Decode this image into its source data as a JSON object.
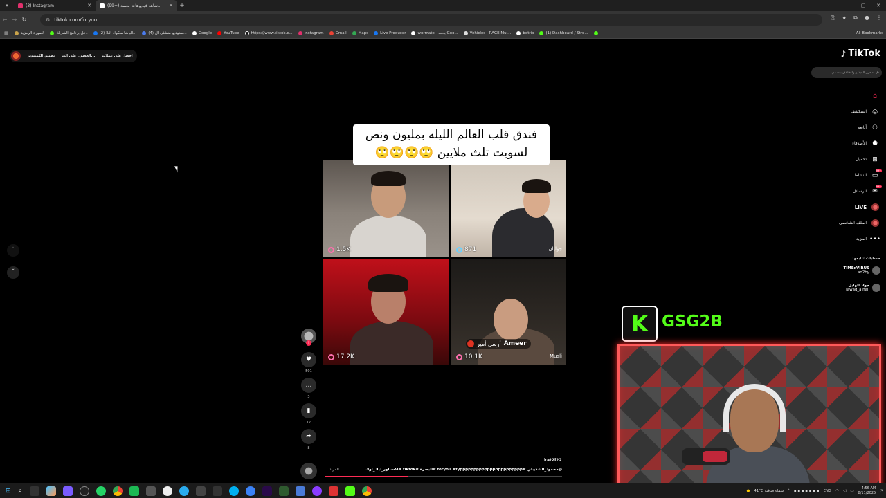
{
  "browser": {
    "tabs": [
      {
        "title": "(3) Instagram",
        "color": "#e1306c",
        "active": false
      },
      {
        "title": "(99+) شاهد فيديوهات متصد...",
        "color": "#ffffff",
        "active": true
      }
    ],
    "url": "tiktok.com/foryou",
    "bookmarks": [
      {
        "label": "الصورة الرمزية",
        "color": "#c9a34b"
      },
      {
        "label": "دخل برنامج الشريك",
        "color": "#53fc18"
      },
      {
        "label": "(2) الباشا سكواد البلا...",
        "color": "#1877f2"
      },
      {
        "label": "(4) ستوديو منشئي ال...",
        "color": "#4b7bec"
      },
      {
        "label": "Google",
        "color": "#ffffff"
      },
      {
        "label": "YouTube",
        "color": "#ff0000"
      },
      {
        "label": "https://www.tiktok.c...",
        "color": "#111111"
      },
      {
        "label": "Instagram",
        "color": "#e1306c"
      },
      {
        "label": "Gmail",
        "color": "#ea4335"
      },
      {
        "label": "Maps",
        "color": "#34a853"
      },
      {
        "label": "Live Producer",
        "color": "#1877f2"
      },
      {
        "label": "wormate - بحث Goo...",
        "color": "#ffffff"
      },
      {
        "label": "Vehicles - RAGE Mul...",
        "color": "#dddddd"
      },
      {
        "label": "botrix",
        "color": "#ffffff"
      },
      {
        "label": "(1) Dashboard / Stre...",
        "color": "#53fc18"
      }
    ],
    "all_bookmarks": "All Bookmarks"
  },
  "tiktok": {
    "top_buttons": [
      "تطبيق الكمبيوتر",
      "الحصول على الت...",
      "احصل على عملات"
    ],
    "logo": "TikTok",
    "search_placeholder": "محرر الفيديو والفنادق بيسمي",
    "nav": [
      {
        "label": "",
        "icon": "home-icon",
        "active": true
      },
      {
        "label": "استكشف",
        "icon": "compass-icon"
      },
      {
        "label": "أتابعه",
        "icon": "following-icon"
      },
      {
        "label": "الأصدقاء",
        "icon": "friends-icon"
      },
      {
        "label": "تحميل",
        "icon": "upload-icon"
      },
      {
        "label": "النشاط",
        "icon": "activity-icon",
        "badge": "99+"
      },
      {
        "label": "الرسائل",
        "icon": "messages-icon",
        "badge": "99+"
      },
      {
        "label": "LIVE",
        "icon": "live-icon"
      },
      {
        "label": "الملف الشخصي",
        "icon": "profile-icon"
      },
      {
        "label": "المزيد",
        "icon": "more-icon"
      }
    ],
    "following_title": "حسابات تتابعها",
    "following": [
      {
        "name": "TIMExVIRUS",
        "handle": "ao2by"
      },
      {
        "name": "جواد الهايل",
        "handle": "jawad_alhail"
      }
    ],
    "video": {
      "caption_line1": "فندق قلب العالم الليله بمليون ونص",
      "caption_line2": "لسويت تلث ملايين 🙄🙄🙄🙄",
      "cells": [
        {
          "count": "1.5K",
          "name": ""
        },
        {
          "count": "871",
          "name": "جوليان"
        },
        {
          "count": "17.2K",
          "name": ""
        },
        {
          "count": "10.1K",
          "name": "Musli"
        }
      ],
      "gift_user": "Ameer",
      "gift_text": "أرسل أمير"
    },
    "actions": [
      {
        "icon": "heart-icon",
        "count": "501"
      },
      {
        "icon": "comment-icon",
        "count": "3"
      },
      {
        "icon": "bookmark-icon",
        "count": "17"
      },
      {
        "icon": "share-icon",
        "count": "8"
      }
    ],
    "author": "kat2l22",
    "hashtags": "@محمود_الشكيبلي #foryou #fyppppppppppppppppppppppp #البصرة #tiktok #اكسبلور_تيك_توك ...",
    "more_label": "المزيد",
    "progress": 0.35
  },
  "stream": {
    "kick_letter": "K",
    "channel": "GSG2B"
  },
  "taskbar": {
    "weather": "41°C سماء صافية",
    "lang": "ENG",
    "time": "4:56 AM",
    "date": "8/11/2025"
  }
}
